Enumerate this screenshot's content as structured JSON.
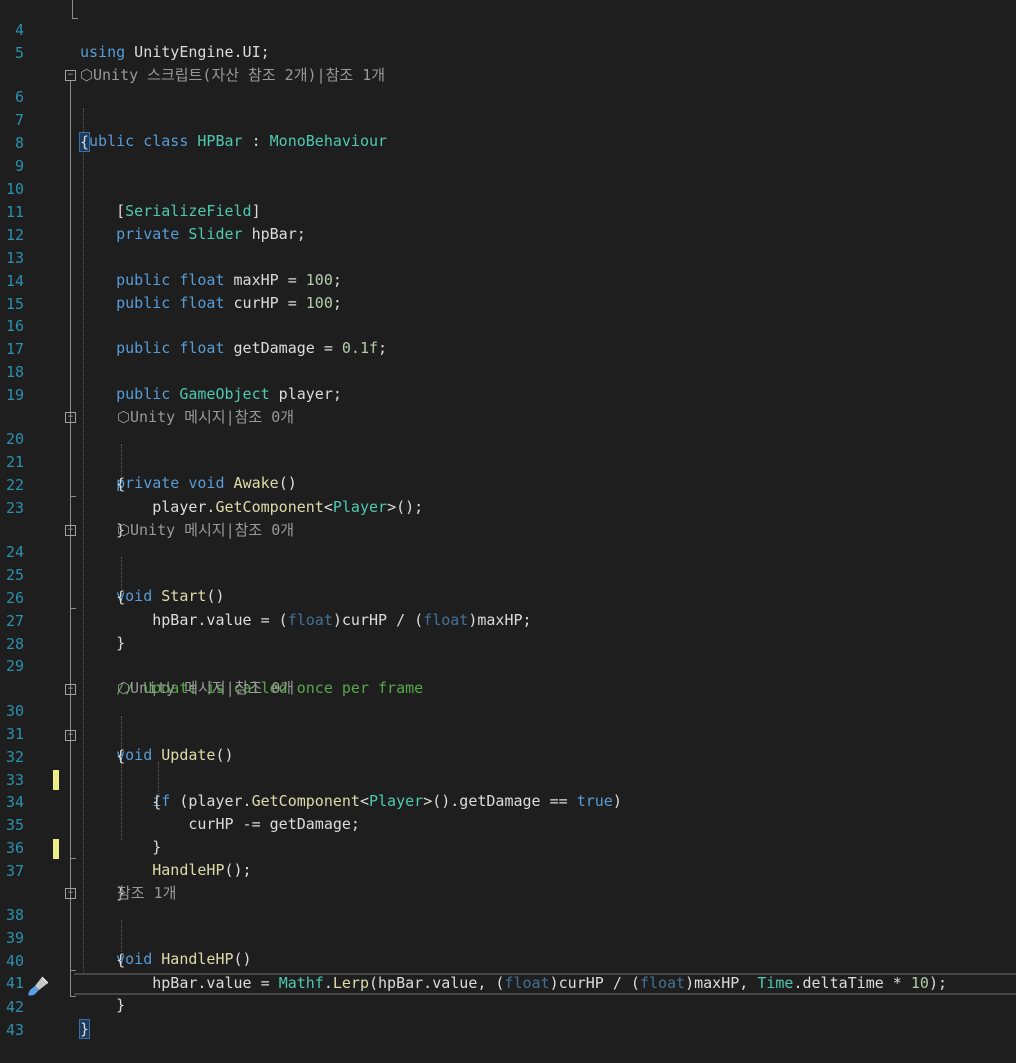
{
  "lines": [
    {
      "n": "4",
      "t": "using UnityEngine.UI;"
    },
    {
      "n": "5",
      "t": ""
    },
    {
      "n": "6",
      "t": "public class HPBar : MonoBehaviour"
    },
    {
      "n": "7",
      "t": "{"
    },
    {
      "n": "8",
      "t": ""
    },
    {
      "n": "9",
      "t": ""
    },
    {
      "n": "10",
      "t": "    [SerializeField]"
    },
    {
      "n": "11",
      "t": "    private Slider hpBar;"
    },
    {
      "n": "12",
      "t": ""
    },
    {
      "n": "13",
      "t": "    public float maxHP = 100;"
    },
    {
      "n": "14",
      "t": "    public float curHP = 100;"
    },
    {
      "n": "15",
      "t": ""
    },
    {
      "n": "16",
      "t": "    public float getDamage = 0.1f;"
    },
    {
      "n": "17",
      "t": ""
    },
    {
      "n": "18",
      "t": "    public GameObject player;"
    },
    {
      "n": "19",
      "t": ""
    },
    {
      "n": "20",
      "t": "    private void Awake()"
    },
    {
      "n": "21",
      "t": "    {"
    },
    {
      "n": "22",
      "t": "        player.GetComponent<Player>();"
    },
    {
      "n": "23",
      "t": "    }"
    },
    {
      "n": "24",
      "t": "    void Start()"
    },
    {
      "n": "25",
      "t": "    {"
    },
    {
      "n": "26",
      "t": "        hpBar.value = (float)curHP / (float)maxHP;"
    },
    {
      "n": "27",
      "t": "    }"
    },
    {
      "n": "28",
      "t": ""
    },
    {
      "n": "29",
      "t": "    // Update is called once per frame"
    },
    {
      "n": "30",
      "t": "    void Update()"
    },
    {
      "n": "31",
      "t": "    {"
    },
    {
      "n": "32",
      "t": "        if (player.GetComponent<Player>().getDamage == true)"
    },
    {
      "n": "33",
      "t": "        {"
    },
    {
      "n": "34",
      "t": "            curHP -= getDamage;"
    },
    {
      "n": "35",
      "t": "        }"
    },
    {
      "n": "36",
      "t": "        HandleHP();"
    },
    {
      "n": "37",
      "t": "    }"
    },
    {
      "n": "38",
      "t": "    void HandleHP()"
    },
    {
      "n": "39",
      "t": "    {"
    },
    {
      "n": "40",
      "t": "        hpBar.value = Mathf.Lerp(hpBar.value, (float)curHP / (float)maxHP, Time.deltaTime * 10);"
    },
    {
      "n": "41",
      "t": "    }"
    },
    {
      "n": "42",
      "t": "}"
    },
    {
      "n": "43",
      "t": ""
    }
  ],
  "codelens": {
    "class": "Unity 스크립트(자산 참조 2개)|참조 1개",
    "awake": "Unity 메시지|참조 0개",
    "start": "Unity 메시지|참조 0개",
    "update": "Unity 메시지|참조 0개",
    "handlehp": "참조 1개"
  },
  "icons": {
    "codelens": "unity-cube-icon",
    "gutter": "paintbrush-icon",
    "fold": "collapse-minus-icon"
  },
  "colors": {
    "background": "#1e1e1e",
    "line_number": "#2b91af",
    "keyword": "#569cd6",
    "type": "#4ec9b0",
    "method": "#dcdcaa",
    "number": "#b5cea8",
    "comment": "#57a64a",
    "change_marker": "#eeee88"
  }
}
